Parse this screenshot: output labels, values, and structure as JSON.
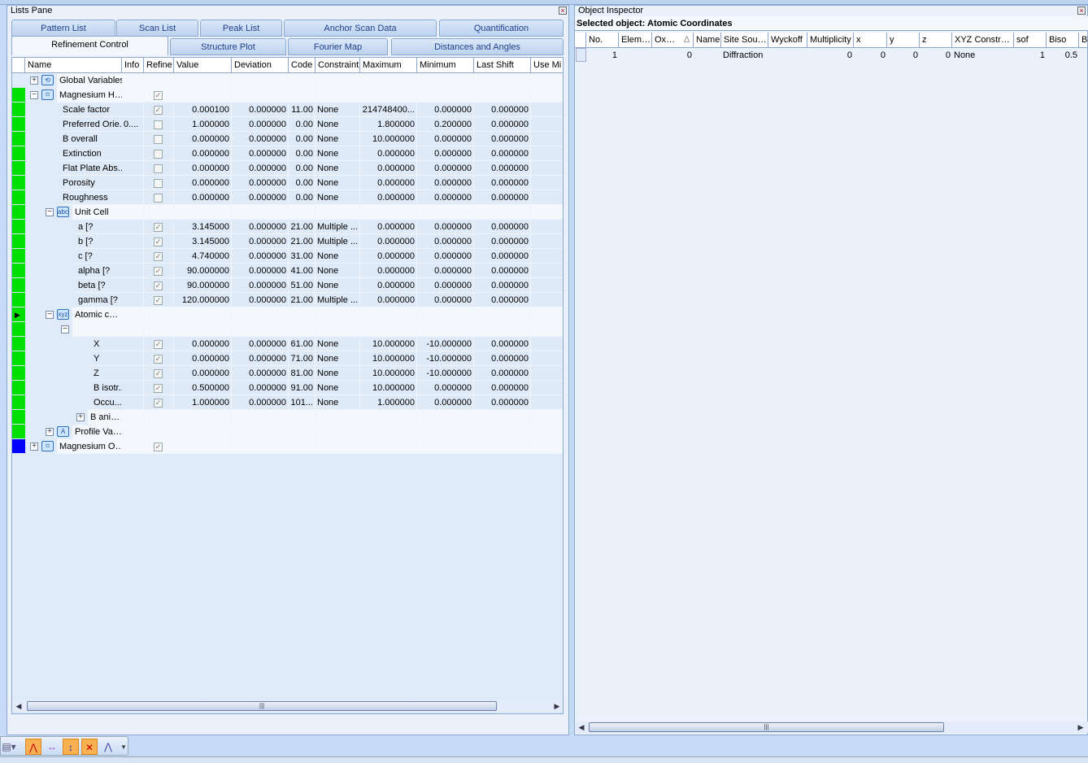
{
  "lists_pane": {
    "title": "Lists Pane",
    "tabs_row1": [
      "Pattern List",
      "Scan List",
      "Peak List",
      "Anchor Scan Data",
      "Quantification"
    ],
    "tabs_row2": [
      "Refinement Control",
      "Structure Plot",
      "Fourier Map",
      "Distances and Angles"
    ],
    "active_tab": "Refinement Control",
    "columns": [
      "Name",
      "Info",
      "Refine",
      "Value",
      "Deviation",
      "Code",
      "Constraint",
      "Maximum",
      "Minimum",
      "Last Shift",
      "Use Mi"
    ],
    "rows": [
      {
        "level": 0,
        "expand": "+",
        "icon": "global",
        "name": "Global Variables",
        "ind": "",
        "group": true
      },
      {
        "level": 0,
        "expand": "-",
        "icon": "phase",
        "name": "Magnesium H…",
        "check": true,
        "ind": "#00e000",
        "group": true
      },
      {
        "level": 1,
        "name": "Scale factor",
        "check": true,
        "value": "0.000100",
        "dev": "0.000000",
        "code": "11.00",
        "con": "None",
        "max": "214748400...",
        "min": "0.000000",
        "last": "0.000000",
        "ind": "#00e000"
      },
      {
        "level": 1,
        "name": "Preferred Orie...",
        "info": "0....",
        "check": false,
        "value": "1.000000",
        "dev": "0.000000",
        "code": "0.00",
        "con": "None",
        "max": "1.800000",
        "min": "0.200000",
        "last": "0.000000",
        "ind": "#00e000"
      },
      {
        "level": 1,
        "name": "B overall",
        "check": false,
        "value": "0.000000",
        "dev": "0.000000",
        "code": "0.00",
        "con": "None",
        "max": "10.000000",
        "min": "0.000000",
        "last": "0.000000",
        "ind": "#00e000"
      },
      {
        "level": 1,
        "name": "Extinction",
        "check": false,
        "value": "0.000000",
        "dev": "0.000000",
        "code": "0.00",
        "con": "None",
        "max": "0.000000",
        "min": "0.000000",
        "last": "0.000000",
        "ind": "#00e000"
      },
      {
        "level": 1,
        "name": "Flat Plate Abs...",
        "check": false,
        "value": "0.000000",
        "dev": "0.000000",
        "code": "0.00",
        "con": "None",
        "max": "0.000000",
        "min": "0.000000",
        "last": "0.000000",
        "ind": "#00e000"
      },
      {
        "level": 1,
        "name": "Porosity",
        "check": false,
        "value": "0.000000",
        "dev": "0.000000",
        "code": "0.00",
        "con": "None",
        "max": "0.000000",
        "min": "0.000000",
        "last": "0.000000",
        "ind": "#00e000"
      },
      {
        "level": 1,
        "name": "Roughness",
        "check": false,
        "value": "0.000000",
        "dev": "0.000000",
        "code": "0.00",
        "con": "None",
        "max": "0.000000",
        "min": "0.000000",
        "last": "0.000000",
        "ind": "#00e000"
      },
      {
        "level": 1,
        "expand": "-",
        "icon": "abc",
        "name": "Unit Cell",
        "ind": "#00e000",
        "group": true
      },
      {
        "level": 2,
        "name": "a [?",
        "check": true,
        "value": "3.145000",
        "dev": "0.000000",
        "code": "21.00",
        "con": "Multiple ...",
        "max": "0.000000",
        "min": "0.000000",
        "last": "0.000000",
        "ind": "#00e000"
      },
      {
        "level": 2,
        "name": "b [?",
        "check": true,
        "value": "3.145000",
        "dev": "0.000000",
        "code": "21.00",
        "con": "Multiple ...",
        "max": "0.000000",
        "min": "0.000000",
        "last": "0.000000",
        "ind": "#00e000"
      },
      {
        "level": 2,
        "name": "c [?",
        "check": true,
        "value": "4.740000",
        "dev": "0.000000",
        "code": "31.00",
        "con": "None",
        "max": "0.000000",
        "min": "0.000000",
        "last": "0.000000",
        "ind": "#00e000"
      },
      {
        "level": 2,
        "name": "alpha [?",
        "check": true,
        "value": "90.000000",
        "dev": "0.000000",
        "code": "41.00",
        "con": "None",
        "max": "0.000000",
        "min": "0.000000",
        "last": "0.000000",
        "ind": "#00e000"
      },
      {
        "level": 2,
        "name": "beta [?",
        "check": true,
        "value": "90.000000",
        "dev": "0.000000",
        "code": "51.00",
        "con": "None",
        "max": "0.000000",
        "min": "0.000000",
        "last": "0.000000",
        "ind": "#00e000"
      },
      {
        "level": 2,
        "name": "gamma [?",
        "check": true,
        "value": "120.000000",
        "dev": "0.000000",
        "code": "21.00",
        "con": "Multiple ...",
        "max": "0.000000",
        "min": "0.000000",
        "last": "0.000000",
        "ind": "#00e000"
      },
      {
        "level": 1,
        "expand": "-",
        "icon": "xyz",
        "name": "Atomic c…",
        "ind": "#00e000",
        "current": true,
        "group": true
      },
      {
        "level": 2,
        "expand": "-",
        "name": "",
        "ind": "#00e000",
        "group": true
      },
      {
        "level": 3,
        "name": "X",
        "check": true,
        "value": "0.000000",
        "dev": "0.000000",
        "code": "61.00",
        "con": "None",
        "max": "10.000000",
        "min": "-10.000000",
        "last": "0.000000",
        "ind": "#00e000"
      },
      {
        "level": 3,
        "name": "Y",
        "check": true,
        "value": "0.000000",
        "dev": "0.000000",
        "code": "71.00",
        "con": "None",
        "max": "10.000000",
        "min": "-10.000000",
        "last": "0.000000",
        "ind": "#00e000"
      },
      {
        "level": 3,
        "name": "Z",
        "check": true,
        "value": "0.000000",
        "dev": "0.000000",
        "code": "81.00",
        "con": "None",
        "max": "10.000000",
        "min": "-10.000000",
        "last": "0.000000",
        "ind": "#00e000"
      },
      {
        "level": 3,
        "name": "B isotr...",
        "check": true,
        "value": "0.500000",
        "dev": "0.000000",
        "code": "91.00",
        "con": "None",
        "max": "10.000000",
        "min": "0.000000",
        "last": "0.000000",
        "ind": "#00e000"
      },
      {
        "level": 3,
        "name": "Occu...",
        "check": true,
        "value": "1.000000",
        "dev": "0.000000",
        "code": "101...",
        "con": "None",
        "max": "1.000000",
        "min": "0.000000",
        "last": "0.000000",
        "ind": "#00e000"
      },
      {
        "level": 3,
        "expand": "+",
        "name": "B ani…",
        "ind": "#00e000",
        "group": true
      },
      {
        "level": 1,
        "expand": "+",
        "icon": "profile",
        "name": "Profile Va…",
        "ind": "#00e000",
        "group": true
      },
      {
        "level": 0,
        "expand": "+",
        "icon": "phase",
        "name": "Magnesium O…",
        "check": true,
        "ind": "#0000ff",
        "group": true
      }
    ]
  },
  "object_inspector": {
    "title": "Object Inspector",
    "selected": "Selected object: Atomic Coordinates",
    "columns": [
      "No.",
      "Elem…",
      "Ox…",
      "Name",
      "Site Sou…",
      "Wyckoff",
      "Multiplicity",
      "x",
      "y",
      "z",
      "XYZ Constr…",
      "sof",
      "Biso",
      "B"
    ],
    "sort_indicator": "∆",
    "row": [
      "1",
      "",
      "0",
      "",
      "Diffraction",
      "",
      "0",
      "0",
      "0",
      "0",
      "None",
      "1",
      "0.5",
      ""
    ]
  },
  "toolbar": {
    "icons": [
      "chart-dropdown-icon",
      "add-peak-icon",
      "peak-width-icon",
      "peak-move-icon",
      "delete-peak-icon",
      "profile-icon",
      "overflow-icon"
    ]
  }
}
